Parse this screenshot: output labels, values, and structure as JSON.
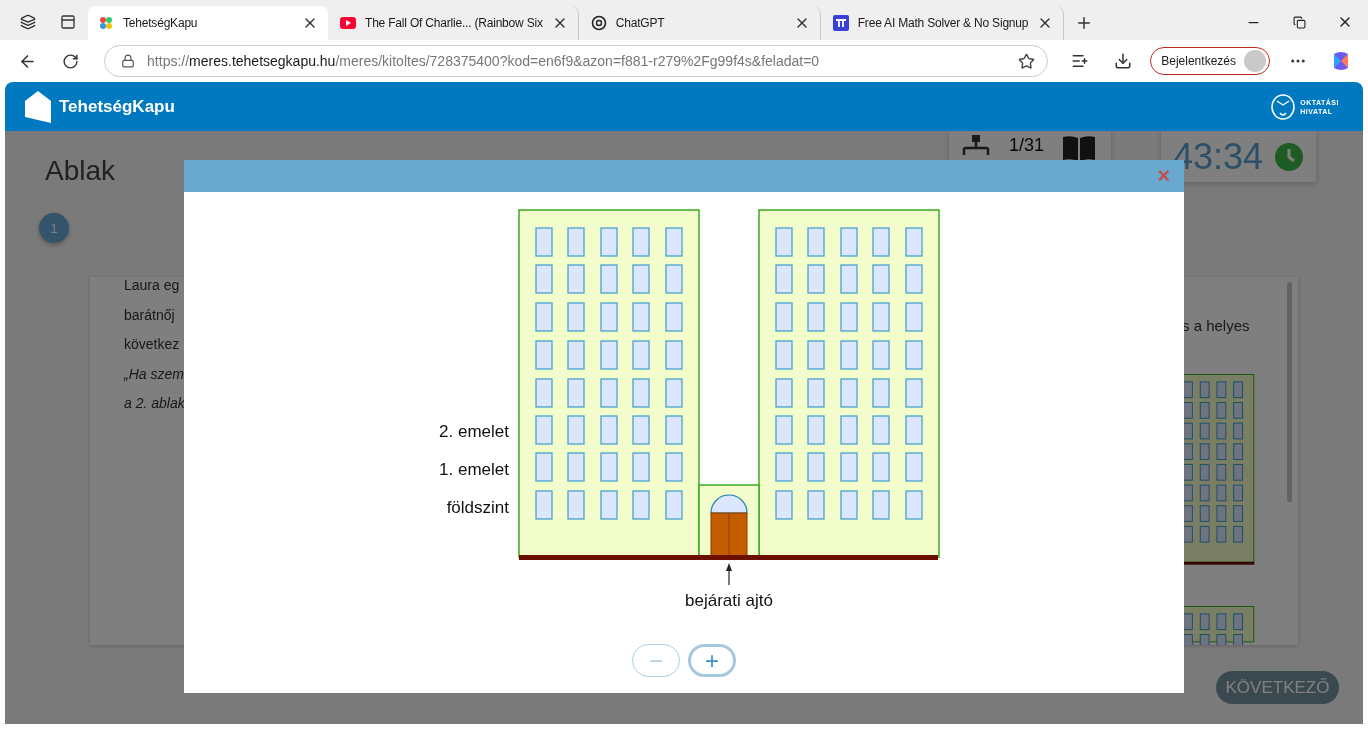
{
  "browser": {
    "tabs": [
      {
        "title": "TehetségKapu",
        "selected": true
      },
      {
        "title": "The Fall Of Charlie... (Rainbow Six",
        "selected": false
      },
      {
        "title": "ChatGPT",
        "selected": false
      },
      {
        "title": "Free AI Math Solver & No Signup",
        "selected": false
      }
    ],
    "address": {
      "scheme": "https://",
      "host": "meres.tehetsegkapu.hu",
      "path": "/meres/kitoltes/728375400?kod=en6f9&azon=f881-r279%2Fg99f4s&feladat=0"
    },
    "sign_in": "Bejelentkezés"
  },
  "header": {
    "brand": "TehetségKapu",
    "agency": [
      "OKTATÁSI",
      "HIVATAL"
    ]
  },
  "page": {
    "title": "Ablak",
    "question_number": "1",
    "counter": "1/31",
    "timer": "43:34",
    "text_lines": [
      {
        "text": "Laura eg",
        "kind": "plain"
      },
      {
        "text": "barátnőj",
        "kind": "plain"
      },
      {
        "text": "következ",
        "kind": "plain"
      },
      {
        "text": "„Ha szem",
        "kind": "italic"
      },
      {
        "text": "a 2. ablak",
        "kind": "italic"
      }
    ],
    "text_right": "s a helyes",
    "next_button": "KÖVETKEZŐ"
  },
  "modal": {
    "close": "×",
    "floor_labels": [
      "2. emelet",
      "1. emelet",
      "földszint"
    ],
    "door_label": "bejárati ajtó",
    "zoom_buttons": [
      {
        "label": "−",
        "disabled": true
      },
      {
        "label": "+",
        "disabled": false
      }
    ]
  }
}
